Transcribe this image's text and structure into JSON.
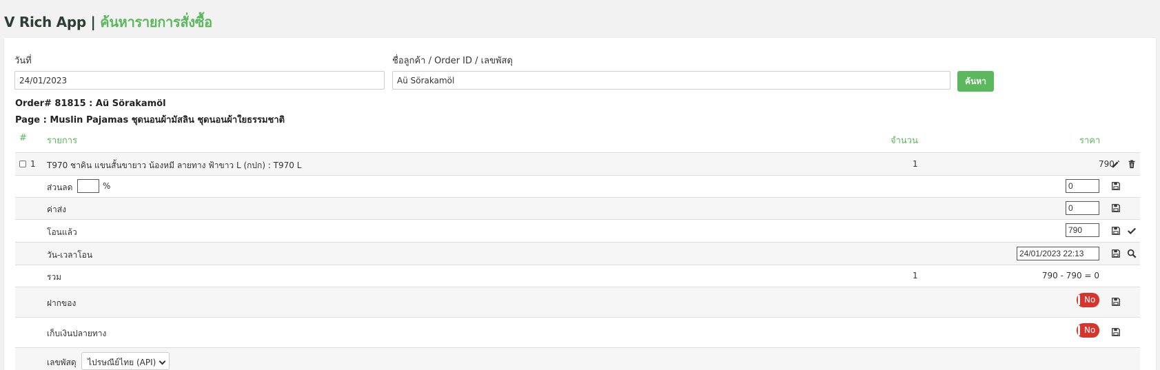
{
  "header": {
    "app_name": "V Rich App",
    "separator": "|",
    "page_title": "ค้นหารายการสั่งซื้อ"
  },
  "filters": {
    "date_label": "วันที่",
    "date_value": "24/01/2023",
    "customer_label": "ชื่อลูกค้า / Order ID / เลขพัสดุ",
    "customer_value": "Aü Sörakamöl",
    "search_button": "ค้นหา"
  },
  "order": {
    "order_line": "Order# 81815 : Aü Sörakamöl",
    "page_line": "Page : Muslin Pajamas ชุดนอนผ้ามัสลิน ชุดนอนผ้าใยธรรมชาติ"
  },
  "table": {
    "headers": {
      "index": "#",
      "item": "รายการ",
      "qty": "จำนวน",
      "price": "ราคา"
    },
    "items": [
      {
        "index": "1",
        "name": "T970 ชาคิน แขนสั้นขายาว น้องหมี ลายทาง ฟ้าขาว L (กปก) : T970 L",
        "qty": "1",
        "price": "790"
      }
    ],
    "discount": {
      "label": "ส่วนลด",
      "percent_value": "",
      "percent_sign": "%",
      "amount": "0"
    },
    "shipping": {
      "label": "ค่าส่ง",
      "amount": "0"
    },
    "transferred": {
      "label": "โอนแล้ว",
      "amount": "790"
    },
    "transfer_time": {
      "label": "วัน-เวลาโอน",
      "value": "24/01/2023 22:13"
    },
    "total": {
      "label": "รวม",
      "qty": "1",
      "value": "790 - 790 = 0"
    },
    "deposit": {
      "label": "ฝากของ",
      "toggle": "No"
    },
    "cod": {
      "label": "เก็บเงินปลายทาง",
      "toggle": "No"
    },
    "tracking": {
      "label": "เลขพัสดุ",
      "carrier": "ไปรษณีย์ไทย (API)"
    }
  },
  "colors": {
    "accent": "#5cb85c",
    "danger": "#d9342b",
    "title_dark": "#2f3e34"
  }
}
